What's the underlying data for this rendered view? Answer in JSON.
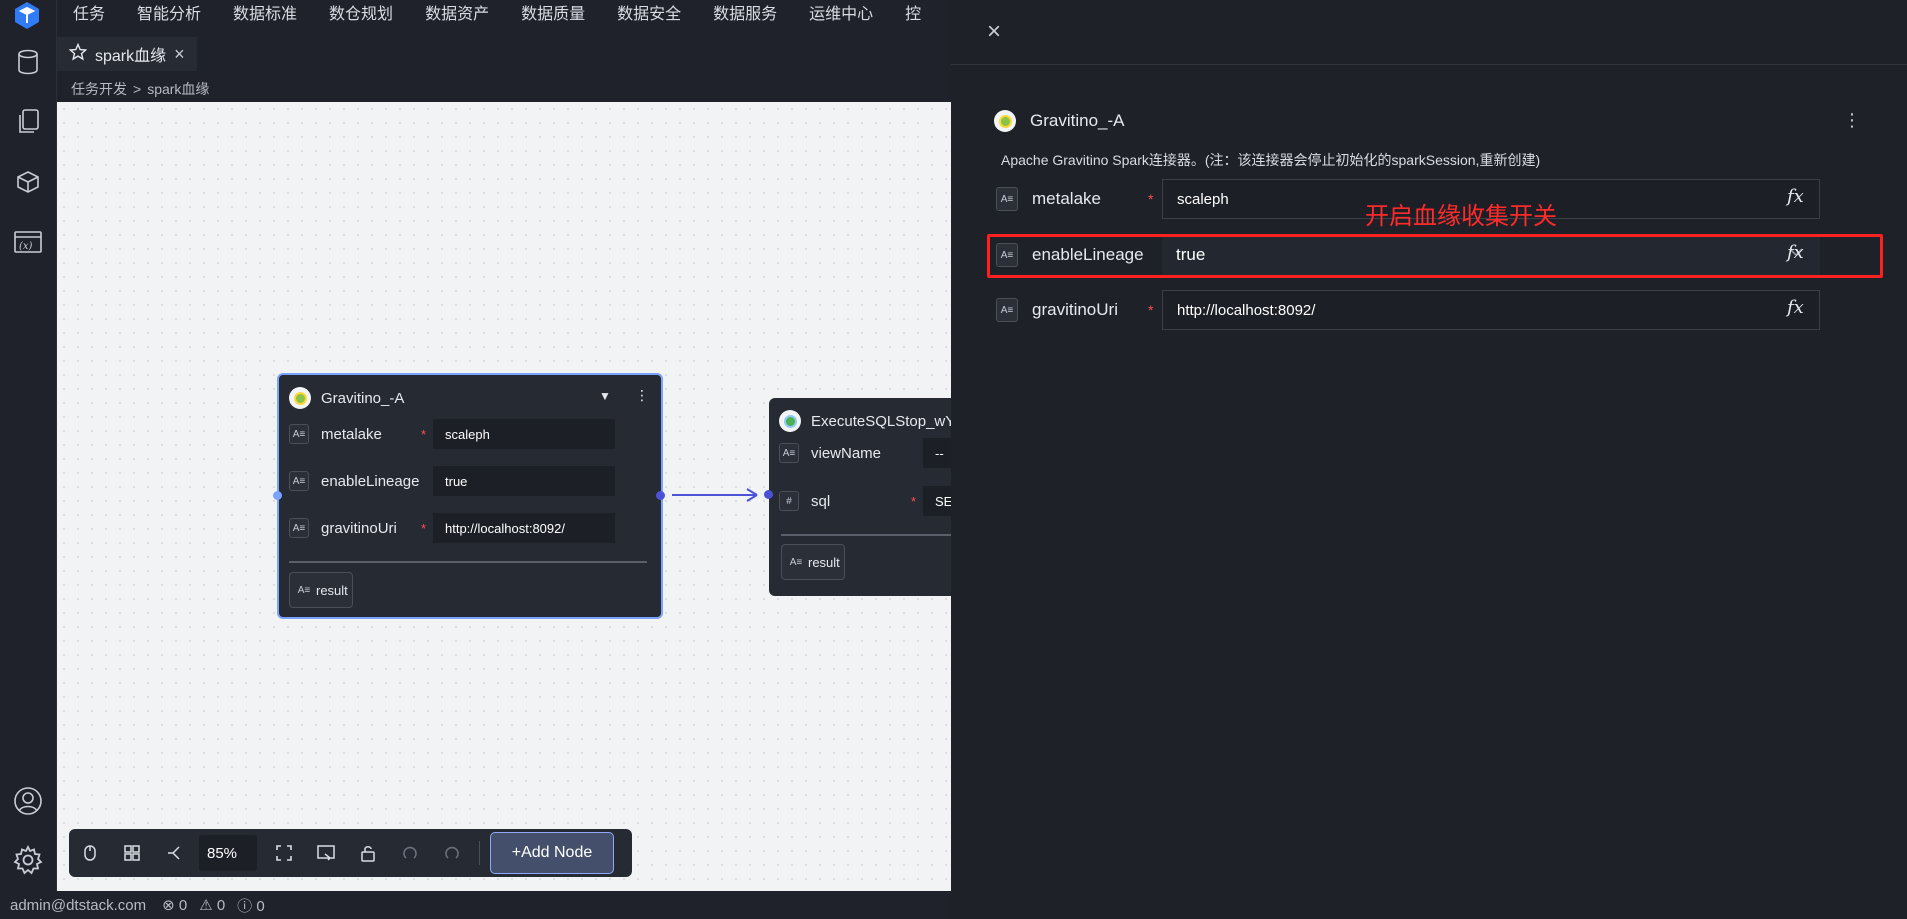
{
  "top_menu": [
    "任务",
    "智能分析",
    "数据标准",
    "数仓规划",
    "数据资产",
    "数据质量",
    "数据安全",
    "数据服务",
    "运维中心",
    "控"
  ],
  "tab": {
    "label": "spark血缘",
    "close": "×"
  },
  "breadcrumb": {
    "parent": "任务开发",
    "sep": ">",
    "current": "spark血缘"
  },
  "node_a": {
    "title": "Gravitino_-A",
    "params": [
      {
        "name": "metalake",
        "required": true,
        "value": "scaleph"
      },
      {
        "name": "enableLineage",
        "required": false,
        "value": "true"
      },
      {
        "name": "gravitinoUri",
        "required": true,
        "value": "http://localhost:8092/"
      }
    ],
    "result": "result"
  },
  "node_b": {
    "title": "ExecuteSQLStop_wY",
    "params": [
      {
        "name": "viewName",
        "icon": "A≡",
        "required": false,
        "value": "--"
      },
      {
        "name": "sql",
        "icon": "#",
        "required": true,
        "value": "SE"
      }
    ],
    "result": "result"
  },
  "toolbar": {
    "zoom": "85%",
    "add_node": "+Add Node"
  },
  "status": {
    "user": "admin@dtstack.com",
    "errors": "0",
    "warnings": "0",
    "infos": "0"
  },
  "panel": {
    "close": "×",
    "title": "Gravitino_-A",
    "description": "Apache Gravitino Spark连接器。(注：该连接器会停止初始化的sparkSession,重新创建)",
    "params": [
      {
        "name": "metalake",
        "value": "scaleph",
        "required": true
      },
      {
        "name": "enableLineage",
        "value": "true",
        "required": false
      },
      {
        "name": "gravitinoUri",
        "value": "http://localhost:8092/",
        "required": true
      }
    ],
    "fx": "fx",
    "annotation": "开启血缘收集开关"
  },
  "colors": {
    "accent": "#7aa3ff",
    "highlight": "#ff2020",
    "required": "#ff4d4f"
  }
}
